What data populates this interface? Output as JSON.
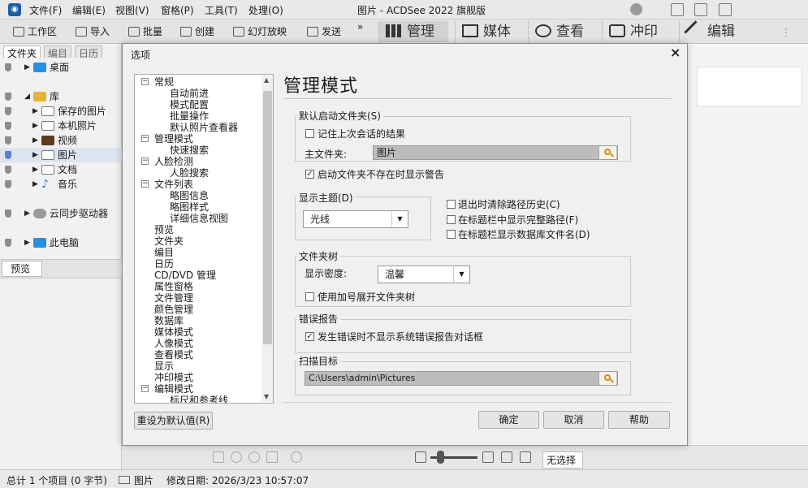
{
  "app": {
    "title": "图片 - ACDSee 2022 旗舰版",
    "menu": [
      "文件(F)",
      "编辑(E)",
      "视图(V)",
      "窗格(P)",
      "工具(T)",
      "处理(O)"
    ]
  },
  "toolbar": {
    "items": [
      "工作区",
      "导入",
      "批量",
      "创建",
      "幻灯放映",
      "发送"
    ],
    "more": "»",
    "modes": [
      "管理",
      "媒体",
      "查看",
      "冲印",
      "编辑"
    ],
    "extra": "⋮"
  },
  "left_panel": {
    "tabs": [
      "文件夹",
      "编目",
      "日历"
    ],
    "tree": [
      "桌面",
      "库",
      "保存的图片",
      "本机照片",
      "视频",
      "图片",
      "文档",
      "音乐",
      "云同步驱动器",
      "此电脑"
    ],
    "preview_tab": "预览"
  },
  "bottom_strip": {
    "no_selection": "无选择"
  },
  "status_bar": {
    "total": "总计 1 个项目 (0 字节)",
    "folder": "图片",
    "modified": "修改日期: 2026/3/23 10:57:07"
  },
  "dialog": {
    "title": "选项",
    "close": "×",
    "nav": [
      "常规",
      "自动前进",
      "模式配置",
      "批量操作",
      "默认照片查看器",
      "管理模式",
      "快速搜索",
      "人脸检测",
      "人脸搜索",
      "文件列表",
      "略图信息",
      "略图样式",
      "详细信息视图",
      "预览",
      "文件夹",
      "编目",
      "日历",
      "CD/DVD 管理",
      "属性窗格",
      "文件管理",
      "颜色管理",
      "数据库",
      "媒体模式",
      "人像模式",
      "查看模式",
      "显示",
      "冲印模式",
      "编辑模式",
      "标尺和参考线"
    ],
    "page_title": "管理模式",
    "startup": {
      "title": "默认启动文件夹(S)",
      "remember_label": "记住上次会话的结果",
      "remember_checked": false,
      "home_label": "主文件夹:",
      "home_value": "图片",
      "warn_label": "启动文件夹不存在时显示警告",
      "warn_checked": true
    },
    "theme": {
      "title": "显示主题(D)",
      "value": "光线"
    },
    "options": [
      {
        "label": "退出时清除路径历史(C)",
        "checked": false
      },
      {
        "label": "在标题栏中显示完整路径(F)",
        "checked": false
      },
      {
        "label": "在标题栏显示数据库文件名(D)",
        "checked": false
      }
    ],
    "folder_tree": {
      "title": "文件夹树",
      "density_label": "显示密度:",
      "density_value": "温馨",
      "plus_label": "使用加号展开文件夹树",
      "plus_checked": false
    },
    "error": {
      "title": "错误报告",
      "label": "发生错误时不显示系统错误报告对话框",
      "checked": true
    },
    "scan": {
      "title": "扫描目标",
      "value": "C:\\Users\\admin\\Pictures"
    },
    "buttons": {
      "reset": "重设为默认值(R)",
      "ok": "确定",
      "cancel": "取消",
      "help": "帮助"
    }
  }
}
